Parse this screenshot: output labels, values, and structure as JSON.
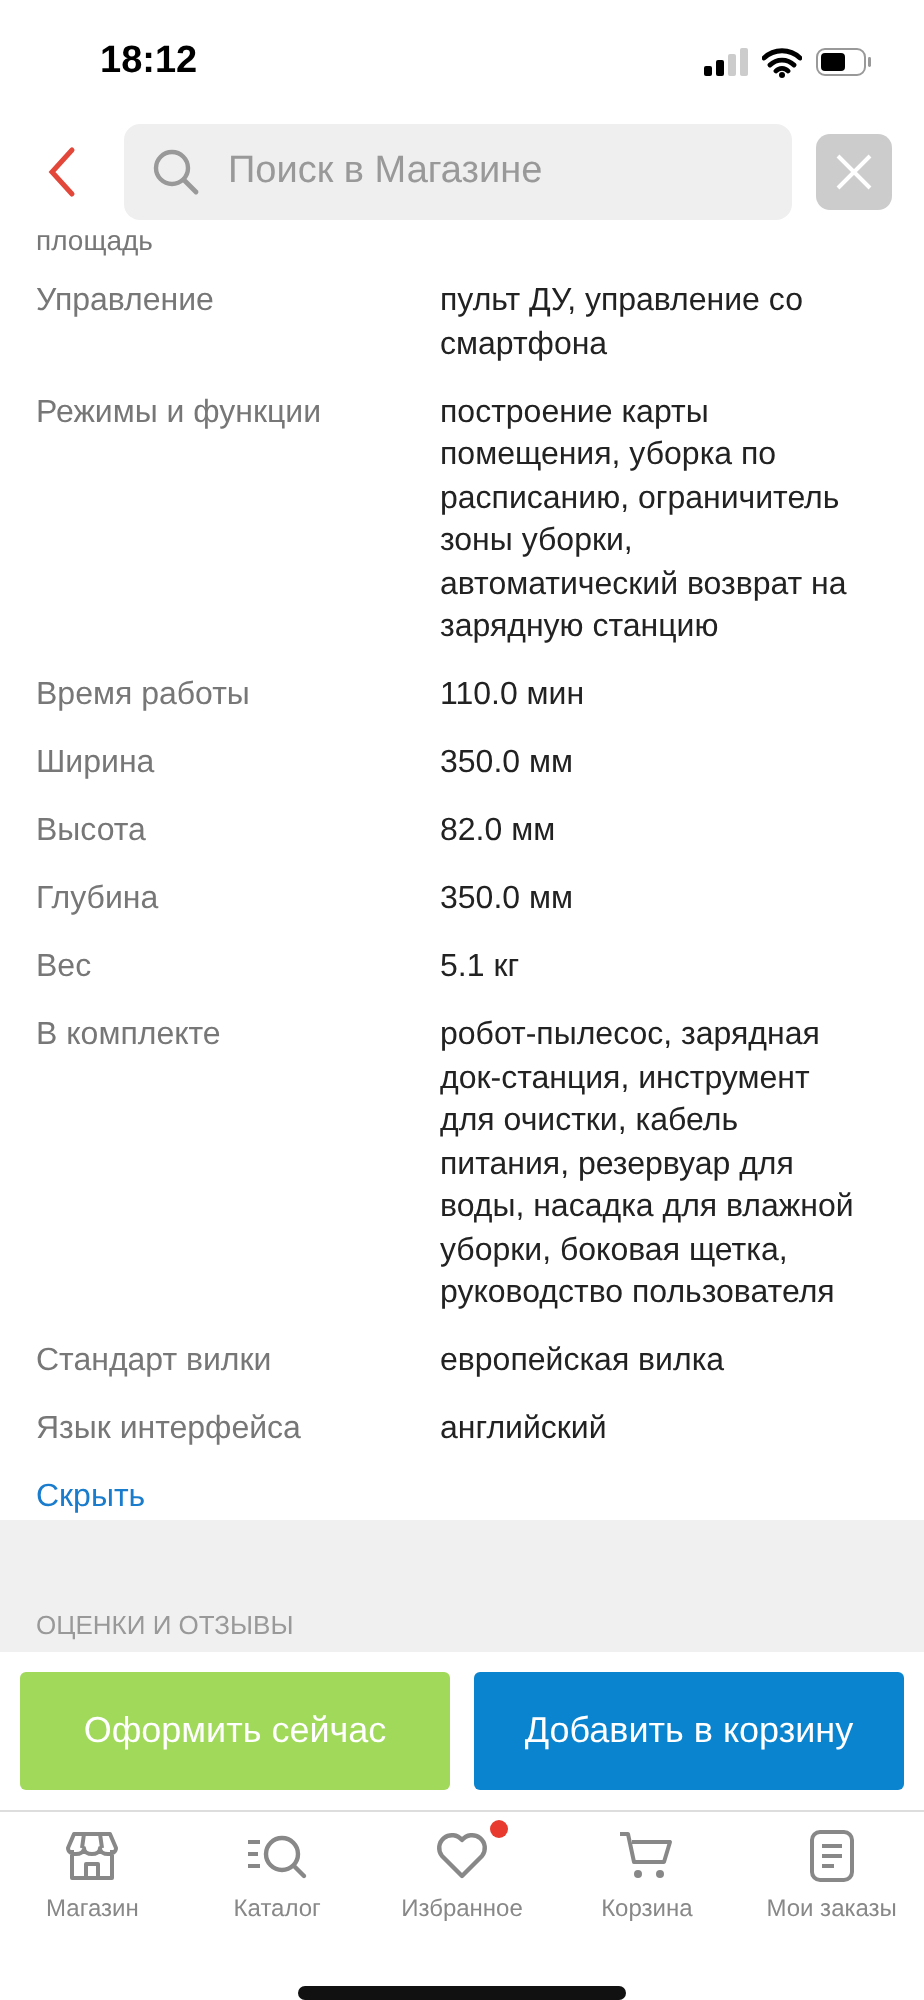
{
  "status_bar": {
    "time": "18:12"
  },
  "search": {
    "placeholder": "Поиск в Магазине"
  },
  "specs_cut_label": "площадь",
  "specs": [
    {
      "label": "Управление",
      "value": "пульт ДУ, управление со смартфона"
    },
    {
      "label": "Режимы и функции",
      "value": "построение карты помещения, уборка по расписанию, ограничитель зоны уборки, автоматический возврат на зарядную станцию"
    },
    {
      "label": "Время работы",
      "value": "110.0 мин"
    },
    {
      "label": "Ширина",
      "value": "350.0 мм"
    },
    {
      "label": "Высота",
      "value": "82.0 мм"
    },
    {
      "label": "Глубина",
      "value": "350.0 мм"
    },
    {
      "label": "Вес",
      "value": "5.1 кг"
    },
    {
      "label": "В комплекте",
      "value": "робот-пылесос, зарядная док-станция, инструмент для очистки, кабель питания, резервуар для воды, насадка для влажной уборки, боковая щетка, руководство пользователя"
    },
    {
      "label": "Стандарт вилки",
      "value": "европейская вилка"
    },
    {
      "label": "Язык интерфейса",
      "value": "английский"
    }
  ],
  "hide_link": "Скрыть",
  "reviews_heading": "ОЦЕНКИ И ОТЗЫВЫ",
  "buttons": [
    {
      "kind": "buy",
      "label": "Оформить сейчас"
    },
    {
      "kind": "cart",
      "label": "Добавить в корзину"
    }
  ],
  "tabs": [
    {
      "kind": "store",
      "label": "Магазин",
      "dot": false
    },
    {
      "kind": "catalog",
      "label": "Каталог",
      "dot": false
    },
    {
      "kind": "favorites",
      "label": "Избранное",
      "dot": true
    },
    {
      "kind": "cart",
      "label": "Корзина",
      "dot": false
    },
    {
      "kind": "orders",
      "label": "Мои заказы",
      "dot": false
    }
  ]
}
